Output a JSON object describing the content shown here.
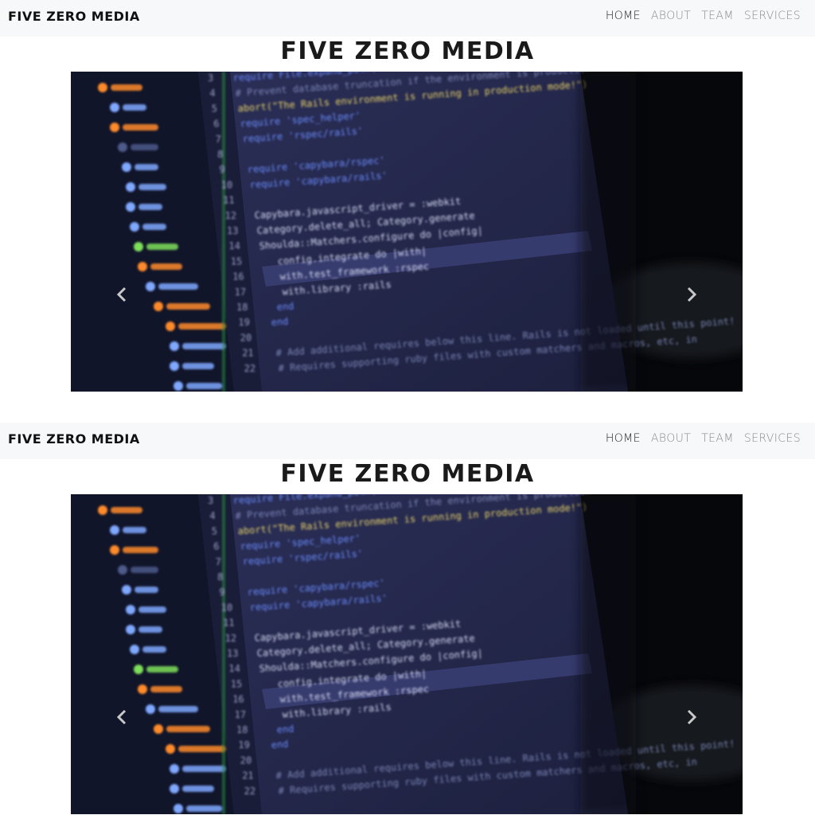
{
  "navbar": {
    "brand": "FIVE ZERO MEDIA",
    "links": [
      {
        "label": "HOME",
        "active": true
      },
      {
        "label": "ABOUT",
        "active": false
      },
      {
        "label": "TEAM",
        "active": false
      },
      {
        "label": "SERVICES",
        "active": false
      }
    ]
  },
  "hero": {
    "title": "FIVE ZERO MEDIA"
  },
  "carousel": {
    "prev_icon": "chevron-left-icon",
    "next_icon": "chevron-right-icon",
    "slide": {
      "line_numbers": [
        "3",
        "4",
        "5",
        "6",
        "7",
        "8",
        "9",
        "10",
        "11",
        "12",
        "13",
        "14",
        "15",
        "16",
        "17",
        "18",
        "19",
        "20",
        "21",
        "22"
      ],
      "code_lines": [
        "require File.expand_path(\"../../config/environment\", __FILE__)",
        "# Prevent database truncation if the environment is production",
        "abort(\"The Rails environment is running in production mode!\")",
        "require 'spec_helper'",
        "require 'rspec/rails'",
        "",
        "require 'capybara/rspec'",
        "require 'capybara/rails'",
        "",
        "Capybara.javascript_driver = :webkit",
        "Category.delete_all; Category.generate",
        "Shoulda::Matchers.configure do |config|",
        "config.integrate do |with|",
        "with.test_framework :rspec",
        "with.library :rails",
        "end",
        "end",
        "",
        "# Add additional requires below this line. Rails is not loaded until this point!",
        "# Requires supporting ruby files with custom matchers and macros, etc, in"
      ]
    }
  },
  "colors": {
    "navbar_bg": "#f7f8fa",
    "brand_text": "#111111",
    "nav_active": "#222222",
    "nav_inactive": "#8a8a8a",
    "screen_bg": "#262a4e",
    "code_blue": "#6b8cff",
    "code_green": "#7ee05a",
    "code_orange": "#ff8a2a"
  }
}
